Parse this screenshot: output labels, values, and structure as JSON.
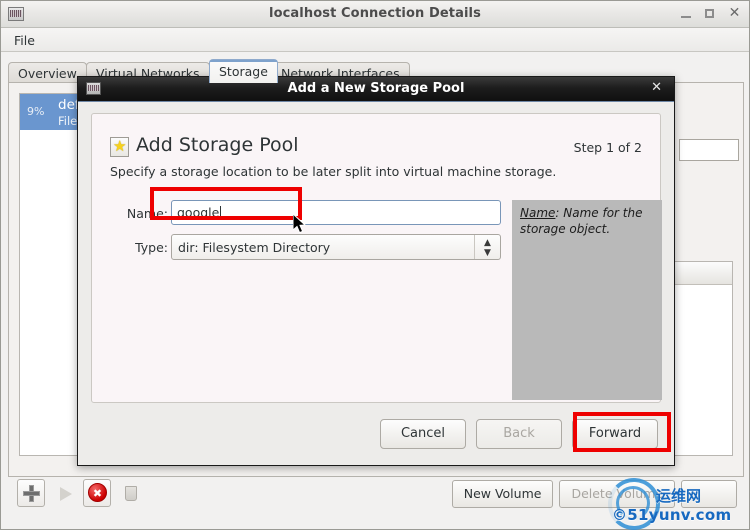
{
  "main_window": {
    "title": "localhost Connection Details",
    "icon": "vm-manager-icon",
    "controls": {
      "minimize": "–",
      "maximize": "□",
      "close": "✕"
    },
    "menubar": {
      "file": "File"
    },
    "tabs": [
      {
        "label": "Overview",
        "active": false
      },
      {
        "label": "Virtual Networks",
        "active": false
      },
      {
        "label": "Storage",
        "active": true
      },
      {
        "label": "Network Interfaces",
        "active": false
      }
    ],
    "pool_list": [
      {
        "percent": "9%",
        "name": "default",
        "type": "Filesystem Directory",
        "selected": true
      }
    ],
    "pool_toolbar": [
      {
        "icon": "plus-icon",
        "label": "Add Pool",
        "disabled": false
      },
      {
        "icon": "play-icon",
        "label": "Start Pool",
        "disabled": true
      },
      {
        "icon": "stop-icon",
        "label": "Stop Pool",
        "disabled": false
      },
      {
        "icon": "trash-icon",
        "label": "Delete Pool",
        "disabled": true
      }
    ],
    "volume_toolbar": {
      "new_volume": "New Volume",
      "delete_volume": "Delete Volume"
    }
  },
  "dialog": {
    "titlebar": {
      "title": "Add a New Storage Pool",
      "icon": "vm-manager-icon",
      "close": "✕"
    },
    "heading": "Add Storage Pool",
    "heading_icon": "new-document-star-icon",
    "step": "Step 1 of 2",
    "subtitle": "Specify a storage location to be later split into virtual machine storage.",
    "fields": {
      "name_label": "Name:",
      "name_value": "google",
      "name_placeholder": "",
      "type_label": "Type:",
      "type_value": "dir: Filesystem Directory"
    },
    "help": {
      "term": "Name",
      "separator": ":",
      "text": " Name for the storage object."
    },
    "buttons": {
      "cancel": "Cancel",
      "back": "Back",
      "forward": "Forward"
    }
  },
  "annotations": {
    "highlight_color": "#ee0000",
    "highlighted": [
      "name-input",
      "forward-button"
    ]
  },
  "watermark": {
    "latin": "©51yunv.com",
    "cjk": "运维网"
  }
}
